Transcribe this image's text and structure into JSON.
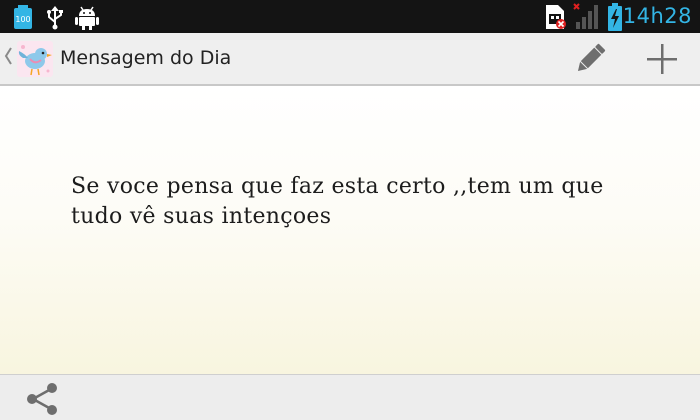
{
  "status_bar": {
    "battery_level_label": "100",
    "time": "14h28",
    "icons": [
      "battery-100-icon",
      "usb-icon",
      "android-debug-icon",
      "sim-error-icon",
      "signal-strength-icon",
      "charging-battery-icon"
    ]
  },
  "action_bar": {
    "title": "Mensagem do Dia",
    "icons": [
      "up-caret-icon",
      "app-bird-icon",
      "pencil-icon",
      "plus-icon"
    ]
  },
  "message": {
    "text": "Se voce pensa que faz esta certo ,,tem um que tudo vê suas intençoes"
  },
  "bottom_bar": {
    "icons": [
      "share-icon"
    ]
  },
  "colors": {
    "status_bar_bg": "#141414",
    "status_accent": "#33b5e5",
    "action_bar_bg": "#efefef",
    "content_bg_top": "#ffffff",
    "content_bg_bottom": "#f8f5df"
  }
}
